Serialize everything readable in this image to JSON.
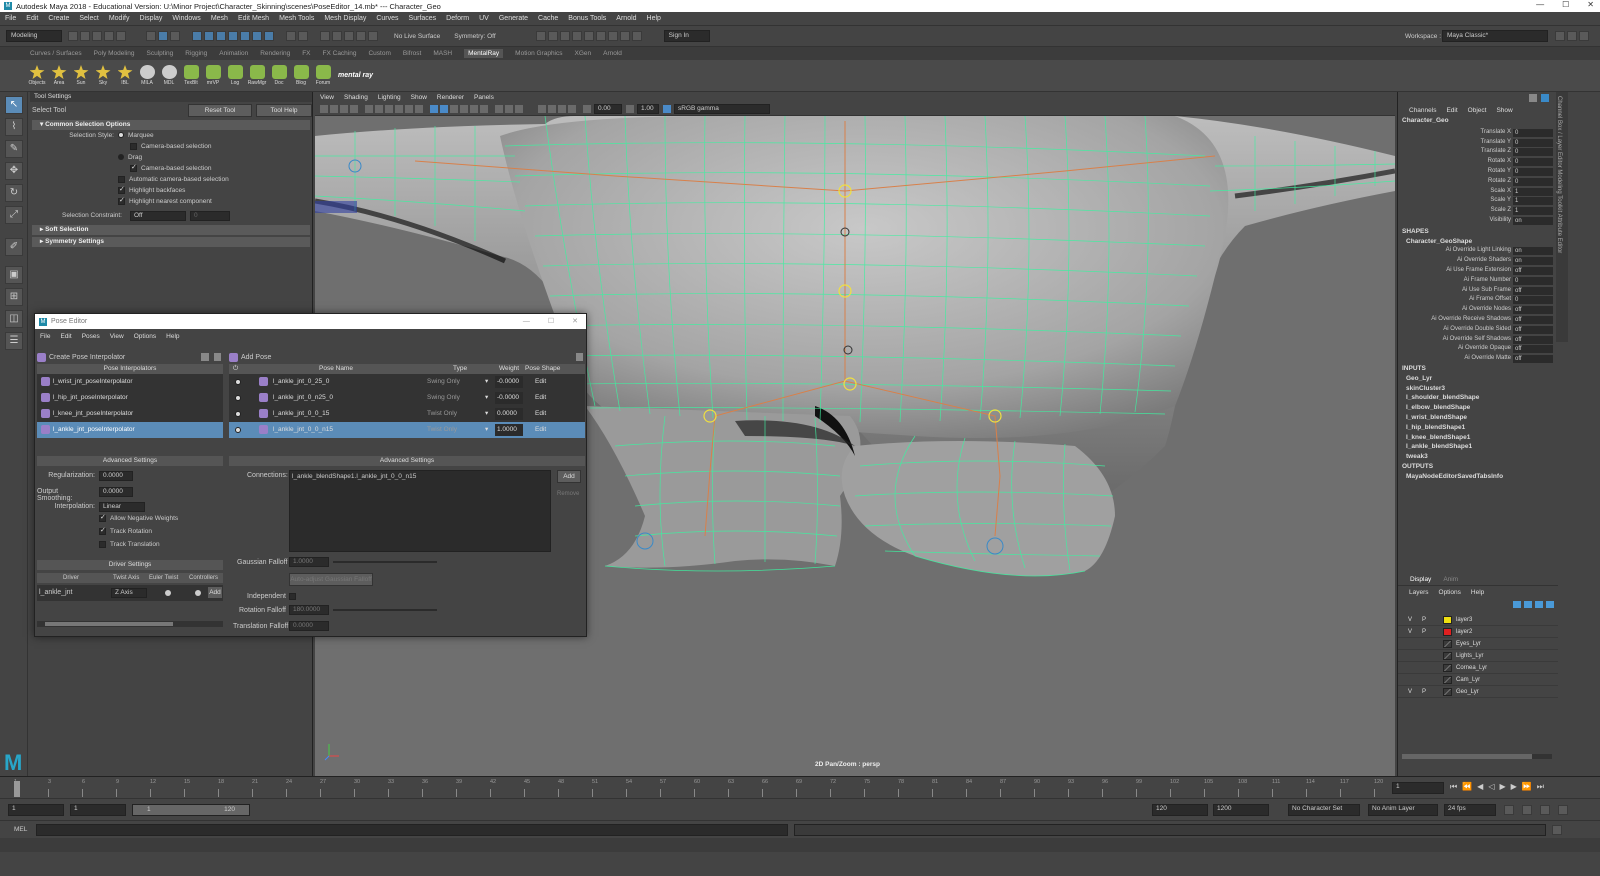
{
  "window": {
    "title": "Autodesk Maya 2018 - Educational Version: U:\\Minor Project\\Character_Skinning\\scenes\\PoseEditor_14.mb*  ---  Character_Geo",
    "logo": "M"
  },
  "menubar": [
    "File",
    "Edit",
    "Create",
    "Select",
    "Modify",
    "Display",
    "Windows",
    "Mesh",
    "Edit Mesh",
    "Mesh Tools",
    "Mesh Display",
    "Curves",
    "Surfaces",
    "Deform",
    "UV",
    "Generate",
    "Cache",
    "Bonus Tools",
    "Arnold",
    "Help"
  ],
  "workspace": {
    "label": "Workspace :",
    "value": "Maya Classic*"
  },
  "statusline": {
    "mode": "Modeling",
    "live_surface": "No Live Surface",
    "symmetry": "Symmetry: Off",
    "signin": "Sign In"
  },
  "shelf_tabs": [
    "Curves / Surfaces",
    "Poly Modeling",
    "Sculpting",
    "Rigging",
    "Animation",
    "Rendering",
    "FX",
    "FX Caching",
    "Custom",
    "Bifrost",
    "MASH",
    "MentalRay",
    "Motion Graphics",
    "XGen",
    "Arnold"
  ],
  "shelf_active": "MentalRay",
  "shelf_icons": [
    {
      "label": "Objects",
      "kind": "y"
    },
    {
      "label": "Area",
      "kind": "y"
    },
    {
      "label": "Sun",
      "kind": "y"
    },
    {
      "label": "Sky",
      "kind": "y"
    },
    {
      "label": "IBL",
      "kind": "y"
    },
    {
      "label": "MILA",
      "kind": "w"
    },
    {
      "label": "MDL",
      "kind": "w"
    },
    {
      "label": "TexBlt",
      "kind": "g"
    },
    {
      "label": "mrVP",
      "kind": "g"
    },
    {
      "label": "Log",
      "kind": "g"
    },
    {
      "label": "RawMgr",
      "kind": "g"
    },
    {
      "label": "Doc",
      "kind": "g"
    },
    {
      "label": "Blog",
      "kind": "g"
    },
    {
      "label": "Forum",
      "kind": "g"
    }
  ],
  "shelf_brand": "mental ray",
  "tool_settings": {
    "header": "Tool Settings",
    "tool": "Select Tool",
    "reset": "Reset Tool",
    "help": "Tool Help",
    "sect_common": "Common Selection Options",
    "style_label": "Selection Style:",
    "marquee": "Marquee",
    "camera_based": "Camera-based selection",
    "drag": "Drag",
    "camera_based2": "Camera-based selection",
    "auto_camera": "Automatic camera-based selection",
    "highlight_backfaces": "Highlight backfaces",
    "highlight_nearest": "Highlight nearest component",
    "constraint_label": "Selection Constraint:",
    "constraint_value": "Off",
    "constraint_num": "0",
    "soft": "Soft Selection",
    "symmetry": "Symmetry Settings"
  },
  "viewport": {
    "menu": [
      "View",
      "Shading",
      "Lighting",
      "Show",
      "Renderer",
      "Panels"
    ],
    "val1": "0.00",
    "val2": "1.00",
    "colorspace": "sRGB gamma",
    "label": "2D Pan/Zoom : persp"
  },
  "pose_editor": {
    "title": "Pose Editor",
    "logo": "M",
    "menu": [
      "File",
      "Edit",
      "Poses",
      "View",
      "Options",
      "Help"
    ],
    "create": "Create Pose Interpolator",
    "add_pose": "Add Pose",
    "interp_header": "Pose Interpolators",
    "interpolators": [
      "l_wrist_jnt_poseInterpolator",
      "l_hip_jnt_poseInterpolator",
      "l_knee_jnt_poseInterpolator",
      "l_ankle_jnt_poseInterpolator"
    ],
    "pose_headers": {
      "name": "Pose Name",
      "type": "Type",
      "weight": "Weight",
      "shape": "Pose Shape"
    },
    "poses": [
      {
        "name": "l_ankle_jnt_0_25_0",
        "type": "Swing Only",
        "weight": "-0.0000",
        "shape": "Edit"
      },
      {
        "name": "l_ankle_jnt_0_n25_0",
        "type": "Swing Only",
        "weight": "-0.0000",
        "shape": "Edit"
      },
      {
        "name": "l_ankle_jnt_0_0_15",
        "type": "Twist Only",
        "weight": "0.0000",
        "shape": "Edit"
      },
      {
        "name": "l_ankle_jnt_0_0_n15",
        "type": "Twist Only",
        "weight": "1.0000",
        "shape": "Edit"
      }
    ],
    "adv_left": {
      "header": "Advanced Settings",
      "reg_label": "Regularization:",
      "reg": "0.0000",
      "smooth_label": "Output Smoothing:",
      "smooth": "0.0000",
      "interp_label": "Interpolation:",
      "interp": "Linear",
      "neg": "Allow Negative Weights",
      "rot": "Track Rotation",
      "trans": "Track Translation"
    },
    "driver": {
      "header": "Driver Settings",
      "cols": [
        "Driver",
        "Twist Axis",
        "Euler Twist",
        "Controllers"
      ],
      "driver": "l_ankle_jnt",
      "axis": "Z Axis",
      "add": "Add"
    },
    "adv_right": {
      "header": "Advanced Settings",
      "conn_label": "Connections:",
      "conn": "l_ankle_blendShape1.l_ankle_jnt_0_0_n15",
      "add": "Add",
      "remove": "Remove",
      "gauss_label": "Gaussian Falloff",
      "gauss": "1.0000",
      "auto": "Auto-adjust Gaussian Falloff",
      "indep": "Independent",
      "rotf_label": "Rotation Falloff",
      "rotf": "180.0000",
      "transf_label": "Translation Falloff",
      "transf": "0.0000"
    }
  },
  "channel_box": {
    "menu": [
      "Channels",
      "Edit",
      "Object",
      "Show"
    ],
    "object": "Character_Geo",
    "channels": [
      {
        "k": "Translate X",
        "v": "0"
      },
      {
        "k": "Translate Y",
        "v": "0"
      },
      {
        "k": "Translate Z",
        "v": "0"
      },
      {
        "k": "Rotate X",
        "v": "0"
      },
      {
        "k": "Rotate Y",
        "v": "0"
      },
      {
        "k": "Rotate Z",
        "v": "0"
      },
      {
        "k": "Scale X",
        "v": "1"
      },
      {
        "k": "Scale Y",
        "v": "1"
      },
      {
        "k": "Scale Z",
        "v": "1"
      },
      {
        "k": "Visibility",
        "v": "on"
      }
    ],
    "shapes_h": "SHAPES",
    "shape": "Character_GeoShape",
    "shape_attrs": [
      {
        "k": "Ai Override Light Linking",
        "v": "on"
      },
      {
        "k": "Ai Override Shaders",
        "v": "on"
      },
      {
        "k": "Ai Use Frame Extension",
        "v": "off"
      },
      {
        "k": "Ai Frame Number",
        "v": "0"
      },
      {
        "k": "Ai Use Sub Frame",
        "v": "off"
      },
      {
        "k": "Ai Frame Offset",
        "v": "0"
      },
      {
        "k": "Ai Override Nodes",
        "v": "off"
      },
      {
        "k": "Ai Override Receive Shadows",
        "v": "off"
      },
      {
        "k": "Ai Override Double Sided",
        "v": "off"
      },
      {
        "k": "Ai Override Self Shadows",
        "v": "off"
      },
      {
        "k": "Ai Override Opaque",
        "v": "off"
      },
      {
        "k": "Ai Override Matte",
        "v": "off"
      }
    ],
    "inputs_h": "INPUTS",
    "inputs": [
      "Geo_Lyr",
      "skinCluster3",
      "l_shoulder_blendShape",
      "l_elbow_blendShape",
      "l_wrist_blendShape",
      "l_hip_blendShape1",
      "l_knee_blendShape1",
      "l_ankle_blendShape1",
      "tweak3"
    ],
    "outputs_h": "OUTPUTS",
    "outputs": [
      "MayaNodeEditorSavedTabsInfo"
    ],
    "side_tabs": "Channel Box / Layer Editor   Modeling Toolkit   Attribute Editor"
  },
  "layer_editor": {
    "tabs": [
      "Display",
      "Anim"
    ],
    "menu": [
      "Layers",
      "Options",
      "Help"
    ],
    "layers": [
      {
        "v": "V",
        "p": "P",
        "name": "layer3",
        "color": "#f0e010"
      },
      {
        "v": "V",
        "p": "P",
        "name": "layer2",
        "color": "#e02020"
      },
      {
        "v": "",
        "p": "",
        "name": "Eyes_Lyr",
        "color": ""
      },
      {
        "v": "",
        "p": "",
        "name": "Lights_Lyr",
        "color": ""
      },
      {
        "v": "",
        "p": "",
        "name": "Cornea_Lyr",
        "color": ""
      },
      {
        "v": "",
        "p": "",
        "name": "Cam_Lyr",
        "color": ""
      },
      {
        "v": "V",
        "p": "P",
        "name": "Geo_Lyr",
        "color": ""
      }
    ]
  },
  "timeline": {
    "ticks": [
      "1",
      "3",
      "6",
      "9",
      "12",
      "15",
      "18",
      "21",
      "24",
      "27",
      "30",
      "33",
      "36",
      "39",
      "42",
      "45",
      "48",
      "51",
      "54",
      "57",
      "60",
      "63",
      "66",
      "69",
      "72",
      "75",
      "78",
      "81",
      "84",
      "87",
      "90",
      "93",
      "96",
      "99",
      "102",
      "105",
      "108",
      "111",
      "114",
      "117",
      "120"
    ],
    "current": "1"
  },
  "range": {
    "start": "1",
    "start2": "1",
    "slider_start": "1",
    "slider_end": "120",
    "end": "120",
    "end2": "1200",
    "char_set": "No Character Set",
    "anim_layer": "No Anim Layer",
    "fps": "24 fps"
  },
  "cmdline": {
    "label": "MEL"
  }
}
